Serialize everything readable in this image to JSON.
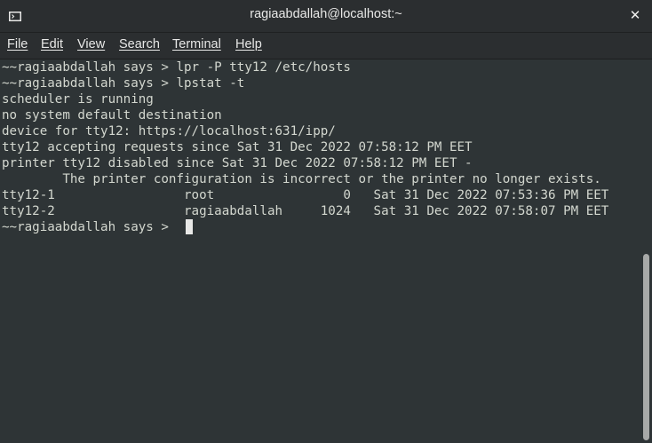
{
  "window": {
    "title": "ragiaabdallah@localhost:~",
    "close_glyph": "✕",
    "icon": "terminal-icon"
  },
  "menu": {
    "items": [
      {
        "label": "File"
      },
      {
        "label": "Edit"
      },
      {
        "label": "View"
      },
      {
        "label": "Search"
      },
      {
        "label": "Terminal"
      },
      {
        "label": "Help"
      }
    ]
  },
  "terminal": {
    "lines": [
      "~~ragiaabdallah says > lpr -P tty12 /etc/hosts",
      "~~ragiaabdallah says > lpstat -t",
      "scheduler is running",
      "no system default destination",
      "device for tty12: https://localhost:631/ipp/",
      "tty12 accepting requests since Sat 31 Dec 2022 07:58:12 PM EET",
      "printer tty12 disabled since Sat 31 Dec 2022 07:58:12 PM EET -",
      "        The printer configuration is incorrect or the printer no longer exists.",
      "tty12-1                 root                 0   Sat 31 Dec 2022 07:53:36 PM EET",
      "tty12-2                 ragiaabdallah     1024   Sat 31 Dec 2022 07:58:07 PM EET",
      "~~ragiaabdallah says > "
    ]
  },
  "colors": {
    "background": "#2e3436",
    "foreground": "#d3d7cf",
    "titlebar": "#2b2e30"
  }
}
